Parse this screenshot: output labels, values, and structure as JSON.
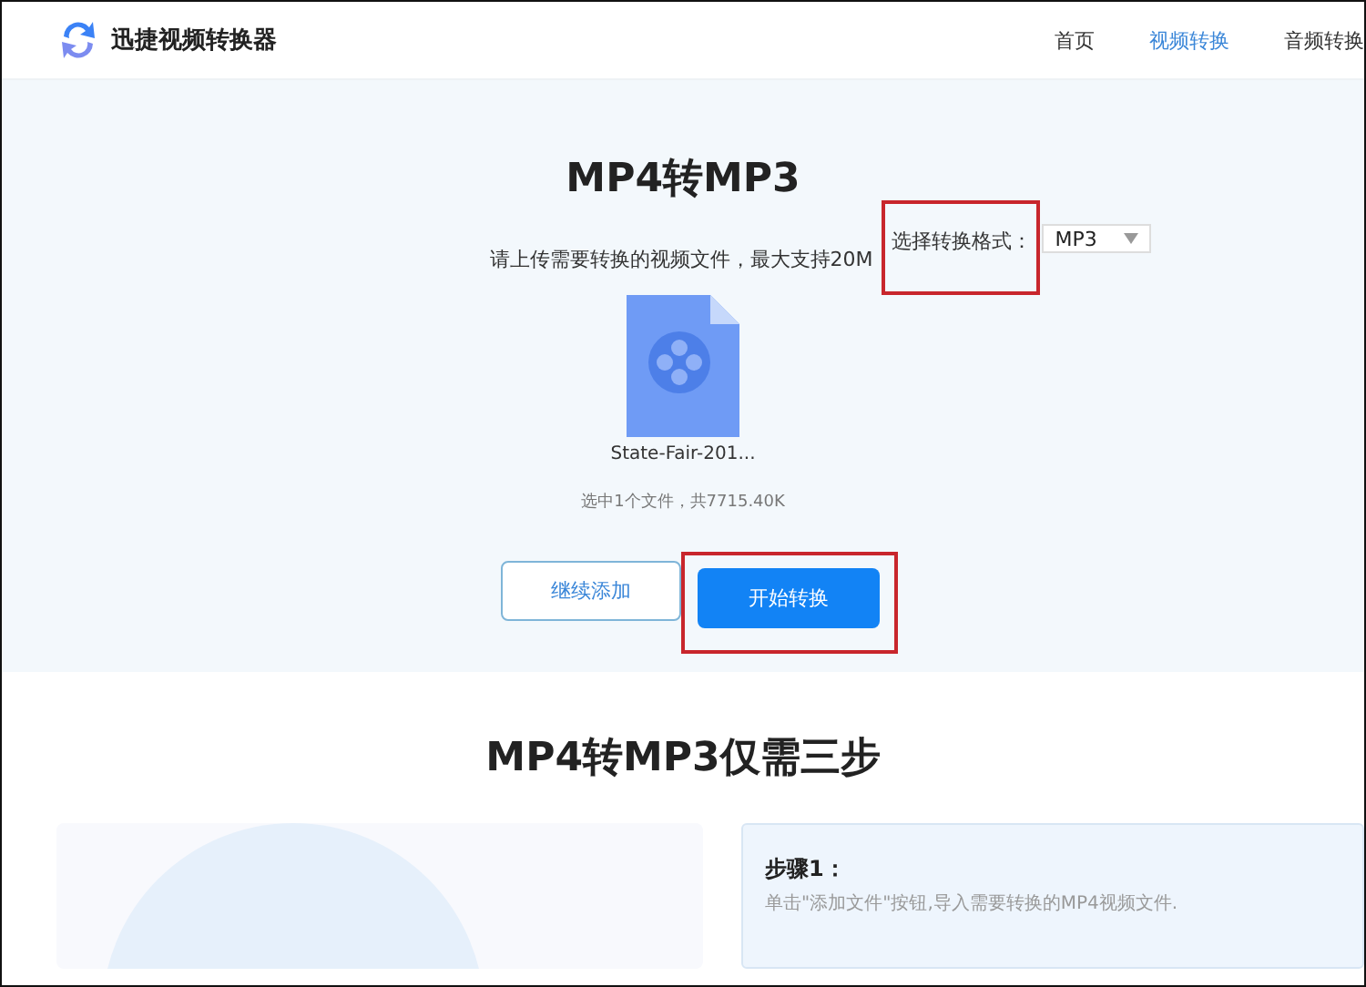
{
  "header": {
    "brand": "迅捷视频转换器",
    "nav": [
      {
        "label": "首页",
        "selected": false
      },
      {
        "label": "视频转换",
        "selected": true
      },
      {
        "label": "音频转换",
        "selected": false
      }
    ]
  },
  "converter": {
    "title": "MP4转MP3",
    "hint": "请上传需要转换的视频文件，最大支持20M",
    "format_label": "选择转换格式：",
    "format_value": "MP3",
    "file_name": "State-Fair-201...",
    "summary": "选中1个文件，共7715.40K",
    "buttons": [
      {
        "label": "继续添加",
        "kind": "secondary"
      },
      {
        "label": "开始转换",
        "kind": "primary"
      }
    ]
  },
  "steps": {
    "title": "MP4转MP3仅需三步",
    "items": [
      {
        "title": "步骤1：",
        "text": "单击\"添加文件\"按钮,导入需要转换的MP4视频文件."
      }
    ]
  }
}
